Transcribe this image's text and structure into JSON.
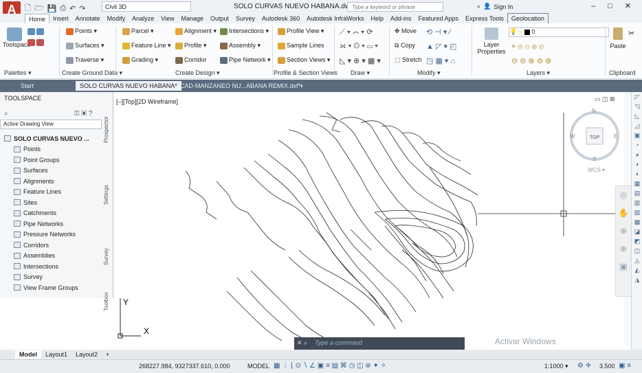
{
  "titlebar": {
    "app_logo": "A",
    "app_logo_sub": "C3D",
    "workspace": "Civil 3D",
    "document_title": "SOLO CURVAS NUEVO HABANA.dwg",
    "search_placeholder": "Type a keyword or phrase",
    "sign_in": "Sign In",
    "window_buttons": [
      "–",
      "□",
      "✕"
    ]
  },
  "ribbon_tabs": [
    "Home",
    "Insert",
    "Annotate",
    "Modify",
    "Analyze",
    "View",
    "Manage",
    "Output",
    "Survey",
    "Autodesk 360",
    "Autodesk InfraWorks",
    "Help",
    "Add-ins",
    "Featured Apps",
    "Express Tools",
    "Geolocation"
  ],
  "active_tab": "Home",
  "ribbon": {
    "toolspace_label": "Toolspace",
    "palettes_title": "Palettes ▾",
    "ground_data": {
      "items": [
        "Points ▾",
        "Surfaces ▾",
        "Traverse ▾"
      ],
      "title": "Create Ground Data ▾"
    },
    "design": {
      "col1": [
        "Parcel ▾",
        "Feature Line ▾",
        "Grading ▾"
      ],
      "col2": [
        "Alignment ▾",
        "Profile ▾",
        "Corridor"
      ],
      "col3": [
        "Intersections ▾",
        "Assembly ▾",
        "Pipe Network ▾"
      ],
      "title": "Create Design ▾"
    },
    "profile_section": {
      "items": [
        "Profile View ▾",
        "Sample Lines",
        "Section Views ▾"
      ],
      "title": "Profile & Section Views"
    },
    "draw_title": "Draw ▾",
    "modify": {
      "items": [
        "Move",
        "Copy",
        "Stretch"
      ],
      "title": "Modify ▾"
    },
    "layers": {
      "layer_props_1": "Layer",
      "layer_props_2": "Properties",
      "layer_value": "0",
      "title": "Layers ▾"
    },
    "clipboard": {
      "paste": "Paste",
      "title": "Clipboard"
    }
  },
  "doc_tabs": [
    "Start",
    "SOLO CURVAS NUEVO HABANA*",
    "ACAD-MANZANEO NU...ABANA REMIX.dxf*"
  ],
  "toolspace": {
    "header": "TOOLSPACE",
    "view": "Active Drawing View",
    "root": "SOLO CURVAS NUEVO ...",
    "nodes": [
      "Points",
      "Point Groups",
      "Surfaces",
      "Alignments",
      "Feature Lines",
      "Sites",
      "Catchments",
      "Pipe Networks",
      "Pressure Networks",
      "Corridors",
      "Assemblies",
      "Intersections",
      "Survey",
      "View Frame Groups"
    ],
    "side_tabs": [
      "Prospector",
      "Settings",
      "Survey",
      "Toolbox"
    ]
  },
  "viewport": {
    "label": "[–][Top][2D Wireframe]",
    "compass_n": "N",
    "compass_s": "S",
    "compass_w": "W",
    "compass_e": "E",
    "compass_top": "TOP",
    "wcs": "WCS ▾",
    "ucs_y": "Y",
    "ucs_x": "X"
  },
  "command": {
    "placeholder": "Type a command"
  },
  "watermark": "Activar Windows",
  "layout_tabs": [
    "Model",
    "Layout1",
    "Layout2",
    "+"
  ],
  "status": {
    "coords": "268227.984, 9327337.610, 0.000",
    "model": "MODEL",
    "scale": "1:1000 ▾",
    "value": "3.500"
  }
}
